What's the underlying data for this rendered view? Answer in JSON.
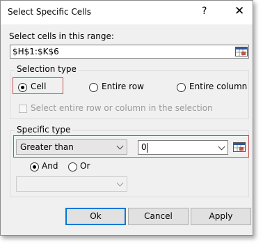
{
  "dialog": {
    "title": "Select Specific Cells",
    "help": "?",
    "close": "✕"
  },
  "range": {
    "label": "Select cells in this range:",
    "value": "$H$1:$K$6"
  },
  "selection_type": {
    "legend": "Selection type",
    "options": [
      "Cell",
      "Entire row",
      "Entire column"
    ],
    "selected": "Cell",
    "checkbox_label": "Select entire row or column in the selection",
    "checkbox_checked": false
  },
  "specific_type": {
    "legend": "Specific type",
    "condition1": "Greater than",
    "value1": "0",
    "logic": [
      "And",
      "Or"
    ],
    "logic_selected": "And",
    "condition2": ""
  },
  "buttons": {
    "ok": "Ok",
    "cancel": "Cancel",
    "apply": "Apply"
  },
  "colors": {
    "highlight": "#c0504d",
    "accent": "#0078d7"
  }
}
